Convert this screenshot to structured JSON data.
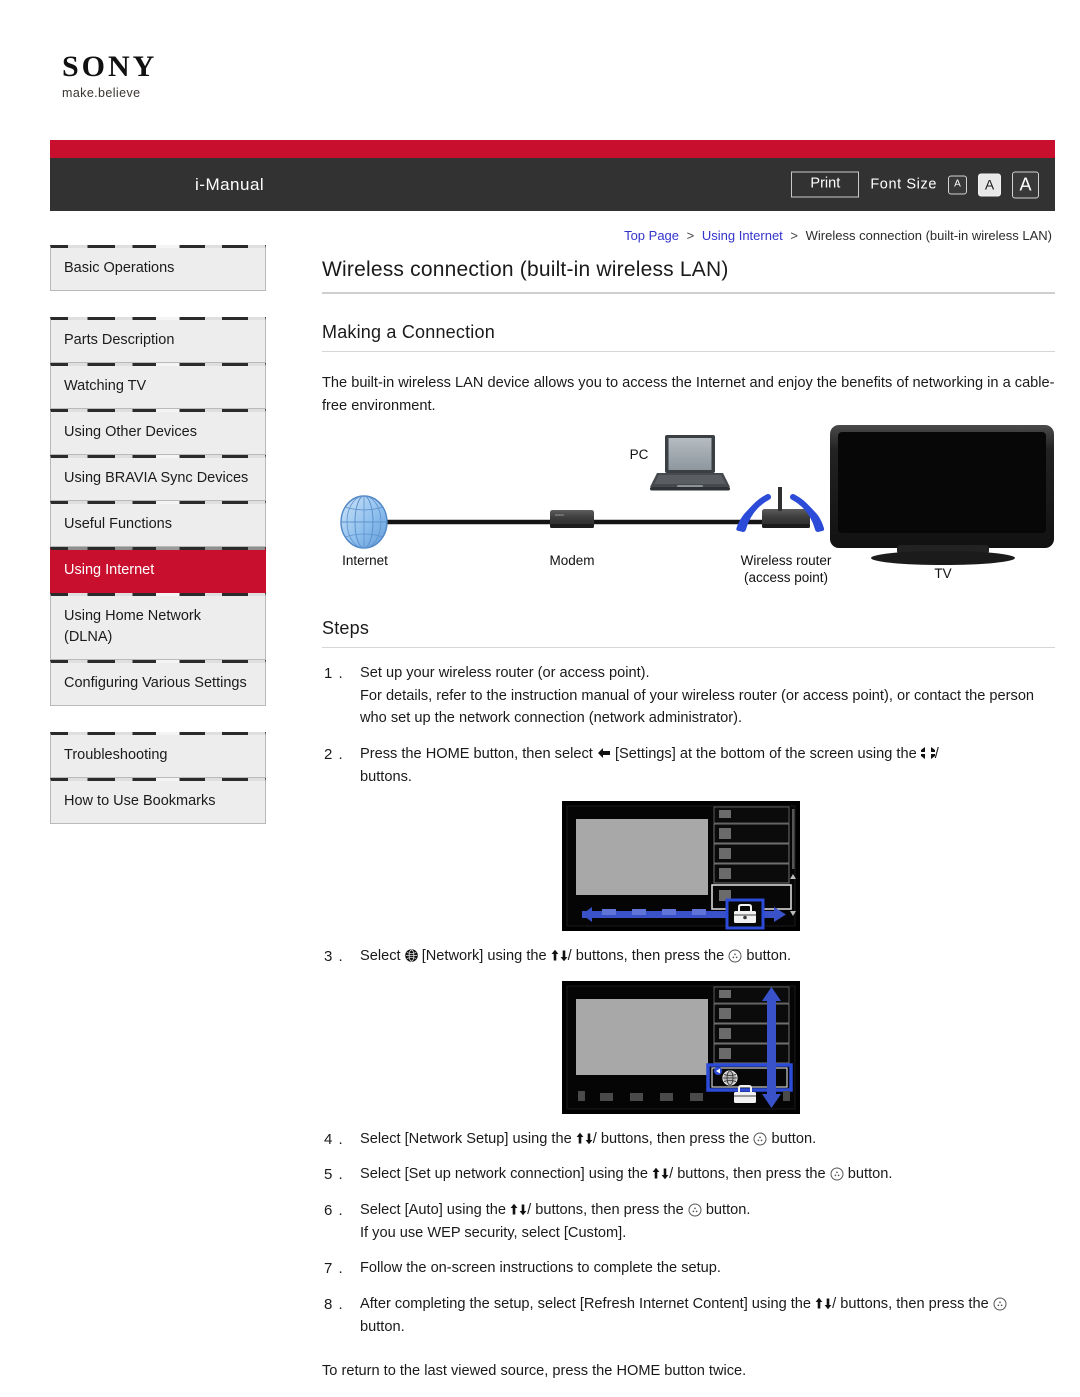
{
  "brand": {
    "name": "SONY",
    "tagline": "make.believe"
  },
  "header": {
    "title": "i-Manual",
    "print_label": "Print",
    "font_size_label": "Font Size",
    "font_sizes": [
      {
        "label": "A",
        "size": "small",
        "selected": false
      },
      {
        "label": "A",
        "size": "medium",
        "selected": true
      },
      {
        "label": "A",
        "size": "large",
        "selected": false
      }
    ],
    "red_accent": "#c8102e",
    "bar_color": "#333232"
  },
  "breadcrumb": {
    "items": [
      {
        "label": "Top Page",
        "link": true
      },
      {
        "label": "Using Internet",
        "link": true
      },
      {
        "label": "Wireless connection (built-in wireless LAN)",
        "link": false
      }
    ],
    "separator": ">"
  },
  "sidebar": {
    "groups": [
      {
        "items": [
          {
            "label": "Basic Operations",
            "active": false
          }
        ]
      },
      {
        "items": [
          {
            "label": "Parts Description",
            "active": false
          },
          {
            "label": "Watching TV",
            "active": false
          },
          {
            "label": "Using Other Devices",
            "active": false
          },
          {
            "label": "Using BRAVIA Sync Devices",
            "active": false
          },
          {
            "label": "Useful Functions",
            "active": false
          },
          {
            "label": "Using Internet",
            "active": true
          },
          {
            "label": "Using Home Network (DLNA)",
            "active": false
          },
          {
            "label": "Configuring Various Settings",
            "active": false
          }
        ]
      },
      {
        "items": [
          {
            "label": "Troubleshooting",
            "active": false
          },
          {
            "label": "How to Use Bookmarks",
            "active": false
          }
        ]
      }
    ],
    "active_color": "#c8102e"
  },
  "main": {
    "page_title": "Wireless connection (built-in wireless LAN)",
    "section1_title": "Making a Connection",
    "intro": "The built-in wireless LAN device allows you to access the Internet and enjoy the benefits of networking in a cable-free environment.",
    "diagram": {
      "labels": {
        "internet": "Internet",
        "modem": "Modem",
        "pc": "PC",
        "router_line1": "Wireless router",
        "router_line2": "(access point)",
        "tv": "TV"
      },
      "wifi_color": "#2b4bd8"
    },
    "section2_title": "Steps",
    "steps": [
      {
        "lines": [
          "Set up your wireless router (or access point).",
          "For details, refer to the instruction manual of your wireless router (or access point), or contact the person who set up the network connection (network administrator)."
        ]
      },
      {
        "parts": {
          "a": "Press the HOME button, then select",
          "b": "[Settings] at the bottom of the screen using the",
          "c": "/",
          "d": "buttons."
        }
      },
      {
        "parts": {
          "a": "Select",
          "b": "[Network] using the",
          "c": "/",
          "d": "buttons, then press the",
          "e": "button."
        }
      },
      {
        "parts": {
          "a": "Select [Network Setup] using the",
          "c": "/",
          "d": "buttons, then press the",
          "e": "button."
        }
      },
      {
        "parts": {
          "a": "Select [Set up network connection] using the",
          "c": "/",
          "d": "buttons, then press the",
          "e": "button."
        }
      },
      {
        "parts": {
          "a": "Select [Auto] using the",
          "c": "/",
          "d": "buttons, then press the",
          "e": "button."
        },
        "sub": "If you use WEP security, select [Custom]."
      },
      {
        "lines": [
          "Follow the on-screen instructions to complete the setup."
        ]
      },
      {
        "parts": {
          "a": "After completing the setup, select [Refresh Internet Content] using the",
          "c": "/",
          "d": "buttons, then press the",
          "e": "button."
        }
      }
    ],
    "closing": "To return to the last viewed source, press the HOME button twice.",
    "tv_screenshot_1": {
      "alt": "TV home menu with Settings toolbox icon highlighted",
      "highlight_color": "#2b4bd8",
      "highlighted_icon": "toolbox-icon"
    },
    "tv_screenshot_2": {
      "alt": "TV settings menu with Network globe item highlighted",
      "highlight_color": "#2b4bd8",
      "highlighted_icon": "globe-icon"
    }
  }
}
